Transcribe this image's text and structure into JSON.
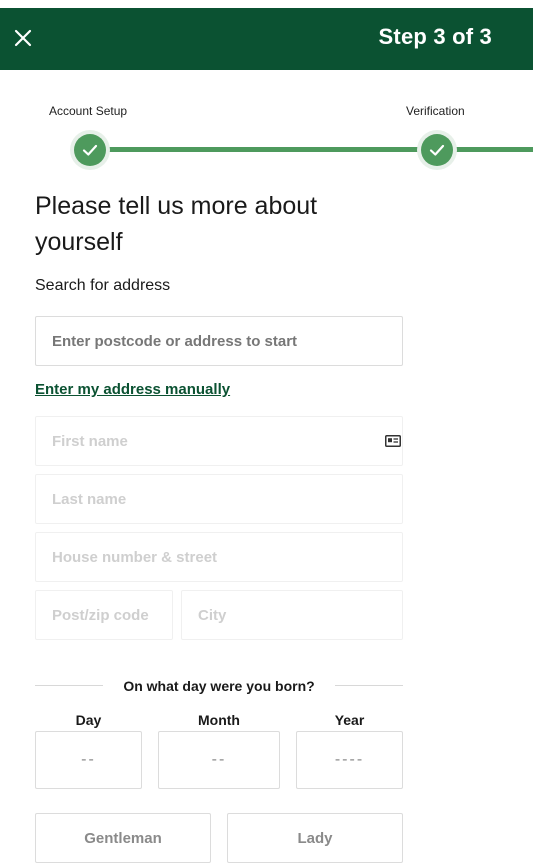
{
  "header": {
    "close_icon": "close-icon",
    "step_label": "Step 3 of 3",
    "background": "#0b5232"
  },
  "progress": {
    "steps": [
      {
        "label": "Account Setup",
        "status": "complete"
      },
      {
        "label": "Verification",
        "status": "complete"
      }
    ],
    "accent": "#4e9a5d"
  },
  "form": {
    "heading": "Please tell us more about yourself",
    "search_label": "Search for address",
    "search_placeholder": "Enter postcode or address to start",
    "manual_link": "Enter my address manually",
    "first_name_placeholder": "First name",
    "last_name_placeholder": "Last name",
    "street_placeholder": "House number & street",
    "postcode_placeholder": "Post/zip code",
    "city_placeholder": "City",
    "id_icon": "id-card-icon"
  },
  "dob": {
    "title": "On what day were you born?",
    "day_label": "Day",
    "month_label": "Month",
    "year_label": "Year",
    "day_value": "--",
    "month_value": "--",
    "year_value": "----"
  },
  "title_options": {
    "gentleman": "Gentleman",
    "lady": "Lady"
  }
}
